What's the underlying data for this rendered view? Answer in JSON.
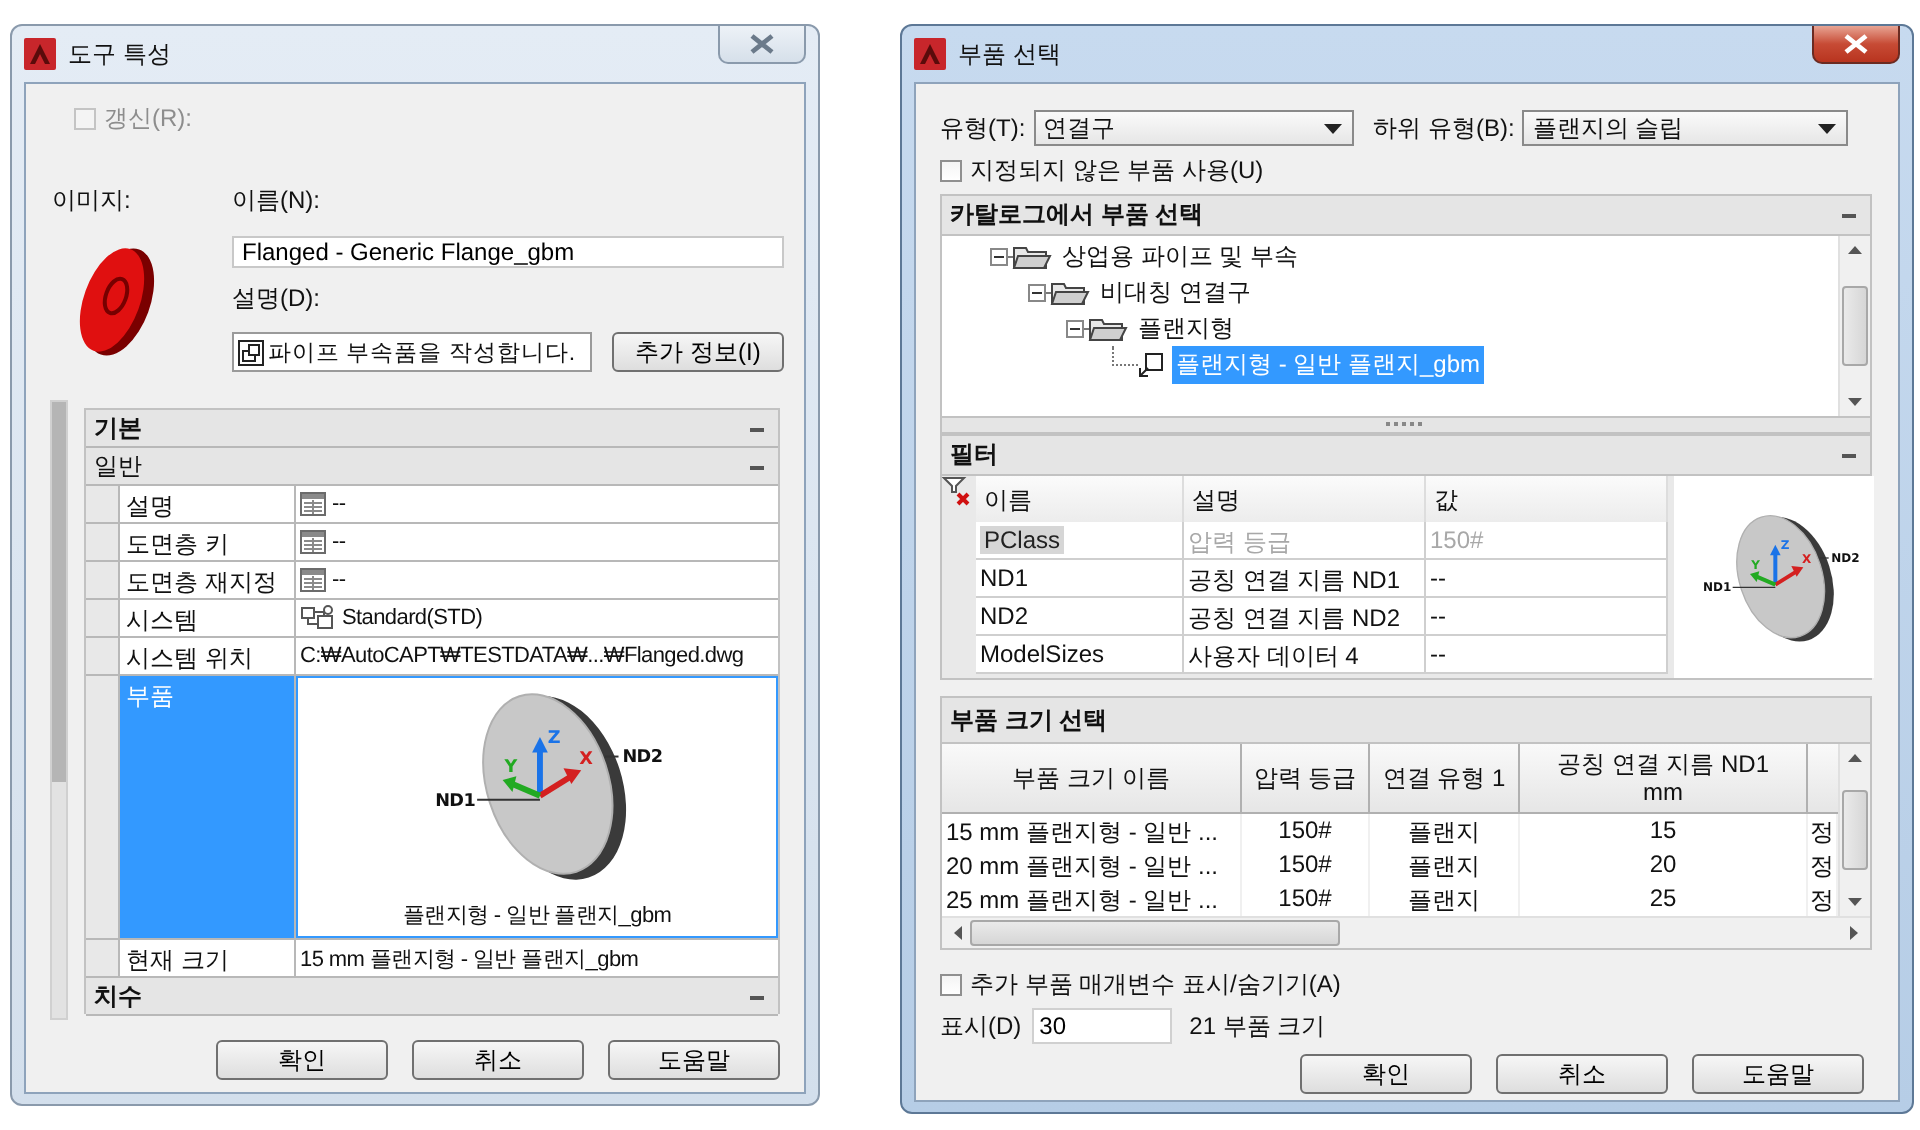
{
  "tool_properties": {
    "title": "도구 특성",
    "active": false,
    "refresh": {
      "label": "갱신(R):",
      "checked": false,
      "disabled": true
    },
    "image_label": "이미지:",
    "name_label": "이름(N):",
    "name_value": "Flanged - Generic Flange_gbm",
    "description_label": "설명(D):",
    "description_value": "파이프 부속품을 작성합니다.",
    "more_info_button": "추가 정보(I)",
    "property_grid": [
      {
        "kind": "category",
        "label": "기본",
        "expanded": true
      },
      {
        "kind": "category",
        "label": "일반",
        "expanded": true
      },
      {
        "kind": "field",
        "name": "설명",
        "value": "--",
        "selected": false
      },
      {
        "kind": "field",
        "name": "도면층 키",
        "value": "--",
        "selected": false
      },
      {
        "kind": "field",
        "name": "도면층 재지정",
        "value": "--",
        "selected": false
      },
      {
        "kind": "system",
        "name": "시스템",
        "value": "Standard(STD)",
        "selected": false
      },
      {
        "kind": "text",
        "name": "시스템 위치",
        "value": "C:₩AutoCAPT₩TESTDATA₩...₩Flanged.dwg",
        "selected": false
      },
      {
        "kind": "preview",
        "name": "부품",
        "caption": "플랜지형 - 일반 플랜지_gbm",
        "labels": [
          "ND1",
          "ND2"
        ],
        "axes": [
          "X",
          "Y",
          "Z"
        ],
        "selected": true
      },
      {
        "kind": "text",
        "name": "현재 크기",
        "value": "15 mm 플랜지형 - 일반 플랜지_gbm",
        "selected": false
      },
      {
        "kind": "category",
        "label": "치수",
        "expanded": true
      }
    ],
    "buttons": [
      "확인",
      "취소",
      "도움말"
    ]
  },
  "part_selection": {
    "title": "부품 선택",
    "active": true,
    "type_label": "유형(T):",
    "type_value": "연결구",
    "subtype_label": "하위 유형(B):",
    "subtype_value": "플랜지의 슬립",
    "unassigned": {
      "label": "지정되지 않은 부품 사용(U)",
      "checked": false
    },
    "catalog": {
      "title": "카탈로그에서 부품 선택",
      "expanded": true,
      "tree": [
        {
          "label": "상업용 파이프 및 부속",
          "expanded": true,
          "selected": false,
          "children": [
            {
              "label": "비대칭 연결구",
              "expanded": true,
              "selected": false,
              "children": [
                {
                  "label": "플랜지형",
                  "expanded": true,
                  "selected": false,
                  "children": [
                    {
                      "label": "플랜지형 - 일반 플랜지_gbm",
                      "selected": true
                    }
                  ]
                }
              ]
            }
          ]
        }
      ]
    },
    "filter": {
      "title": "필터",
      "expanded": true,
      "columns": [
        "이름",
        "설명",
        "값"
      ],
      "rows": [
        {
          "cells": [
            "PClass",
            "압력 등급",
            "150#"
          ],
          "disabled": true
        },
        {
          "cells": [
            "ND1",
            "공칭 연결 지름 ND1",
            "--"
          ],
          "disabled": false
        },
        {
          "cells": [
            "ND2",
            "공칭 연결 지름 ND2",
            "--"
          ],
          "disabled": false
        },
        {
          "cells": [
            "ModelSizes",
            "사용자 데이터 4",
            "--"
          ],
          "disabled": false
        }
      ],
      "preview": {
        "labels": [
          "ND1",
          "ND2"
        ],
        "axes": [
          "X",
          "Y",
          "Z"
        ]
      }
    },
    "part_size": {
      "title": "부품 크기 선택",
      "columns": [
        "부품 크기 이름",
        "압력 등급",
        "연결 유형 1",
        "공칭 연결 지름 ND1 mm"
      ],
      "rows": [
        [
          "15 mm 플랜지형 - 일반 ...",
          "150#",
          "플랜지",
          "15",
          "정"
        ],
        [
          "20 mm 플랜지형 - 일반 ...",
          "150#",
          "플랜지",
          "20",
          "정"
        ],
        [
          "25 mm 플랜지형 - 일반 ...",
          "150#",
          "플랜지",
          "25",
          "정"
        ]
      ]
    },
    "show_extra": {
      "label": "추가 부품 매개변수 표시/숨기기(A)",
      "checked": false
    },
    "display_label": "표시(D)",
    "display_value": "30",
    "count": "21 부품 크기",
    "buttons": [
      "확인",
      "취소",
      "도움말"
    ]
  }
}
